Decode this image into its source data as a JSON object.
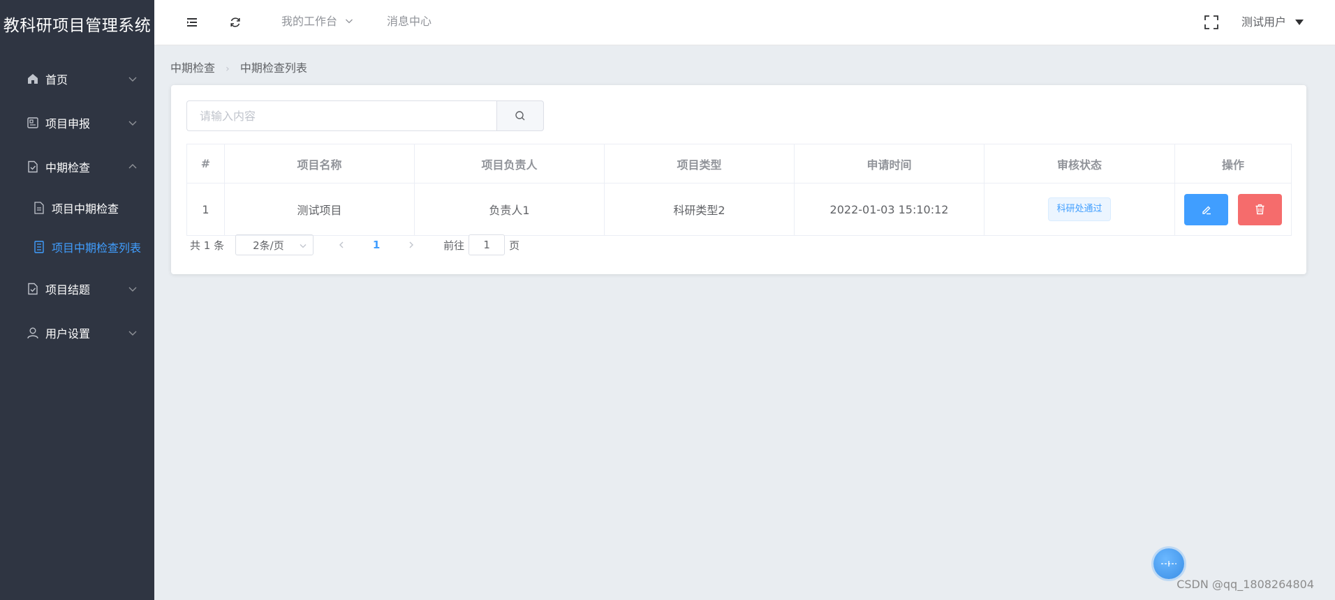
{
  "app": {
    "title": "教科研项目管理系统"
  },
  "sidebar": {
    "items": [
      {
        "label": "首页"
      },
      {
        "label": "项目申报"
      },
      {
        "label": "中期检查"
      },
      {
        "label": "项目中期检查"
      },
      {
        "label": "项目中期检查列表"
      },
      {
        "label": "项目结题"
      },
      {
        "label": "用户设置"
      }
    ]
  },
  "topbar": {
    "workbench": "我的工作台",
    "messages": "消息中心",
    "user": "测试用户"
  },
  "breadcrumb": {
    "parent": "中期检查",
    "current": "中期检查列表"
  },
  "search": {
    "placeholder": "请输入内容"
  },
  "table": {
    "headers": [
      "#",
      "项目名称",
      "项目负责人",
      "项目类型",
      "申请时间",
      "审核状态",
      "操作"
    ],
    "rows": [
      {
        "index": "1",
        "name": "测试项目",
        "leader": "负责人1",
        "type": "科研类型2",
        "time": "2022-01-03 15:10:12",
        "status": "科研处通过"
      }
    ]
  },
  "pagination": {
    "total_text": "共 1 条",
    "page_size": "2条/页",
    "current_page": "1",
    "goto_label": "前往",
    "goto_value": "1",
    "goto_suffix": "页"
  },
  "watermark": "CSDN @qq_1808264804"
}
